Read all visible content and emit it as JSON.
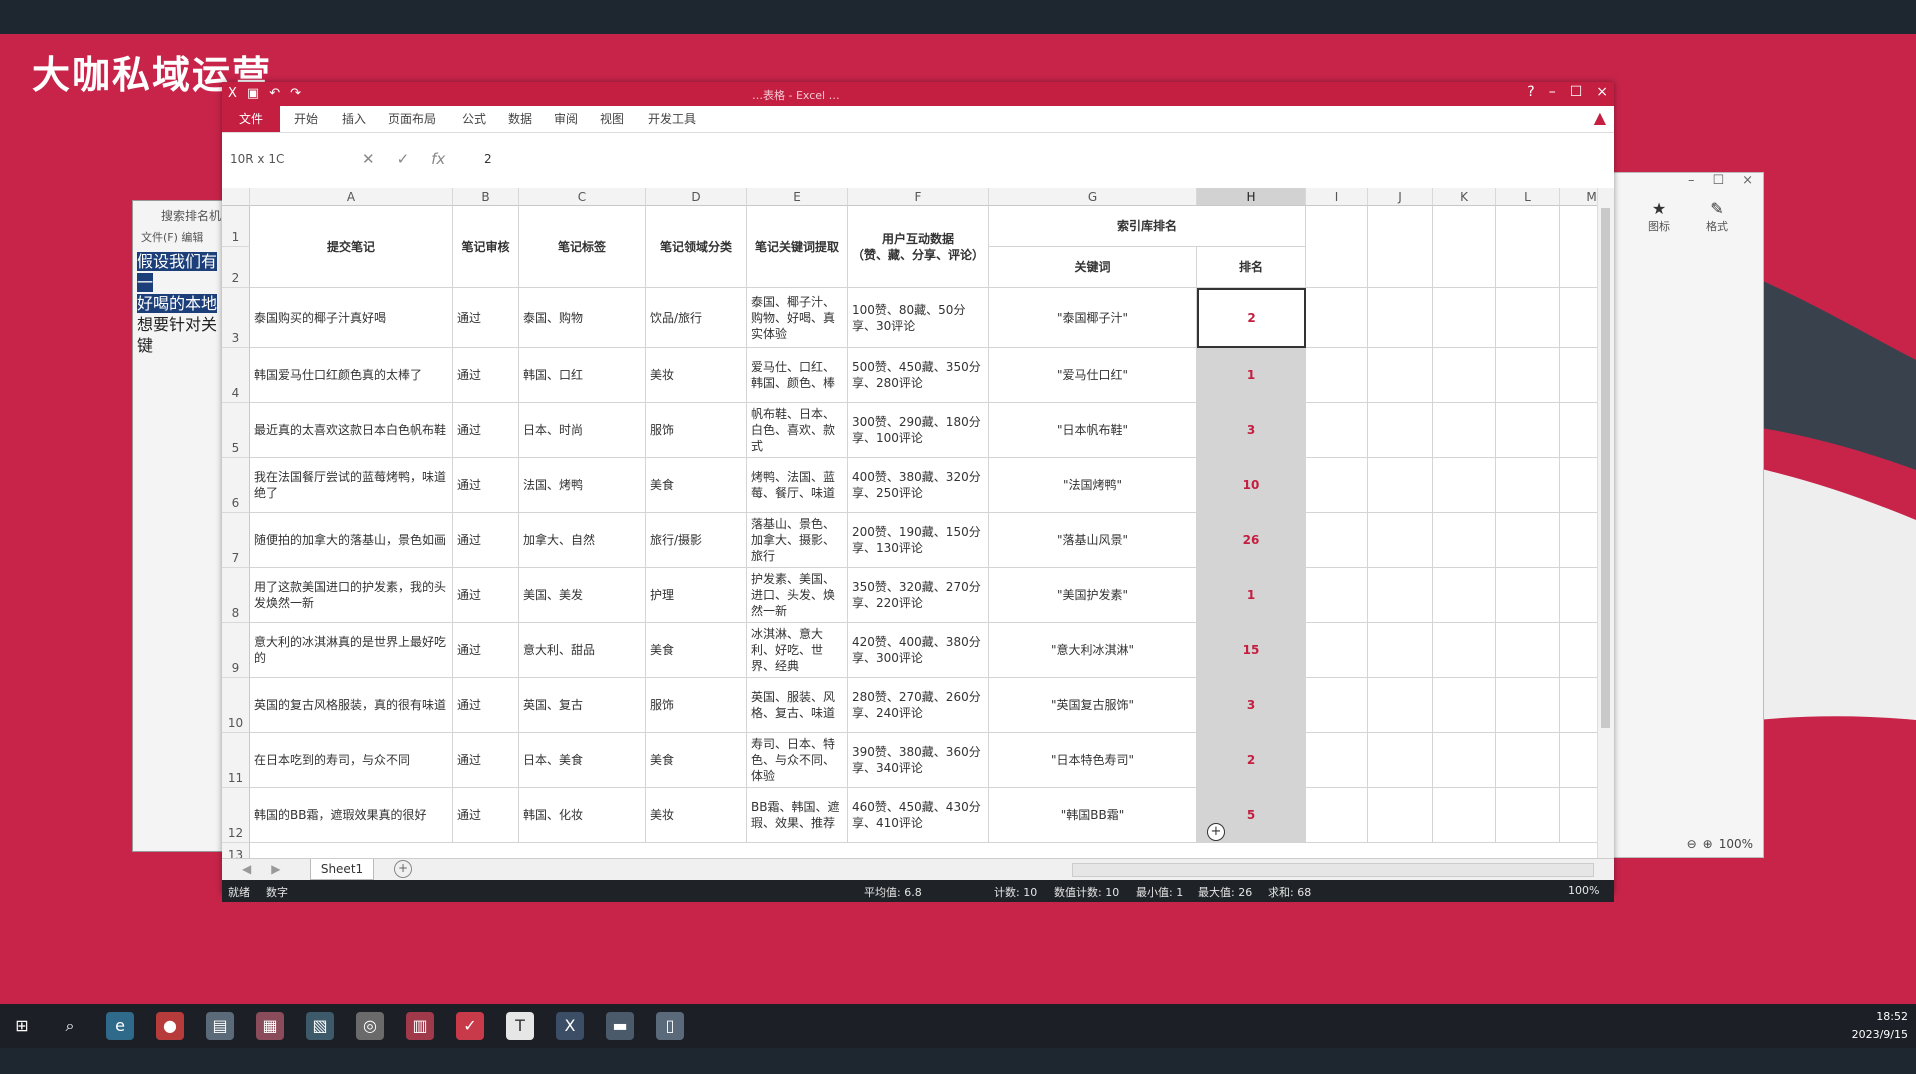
{
  "overlay": {
    "watermark": "大咖私域运营"
  },
  "note_window": {
    "title": "搜索排名机",
    "menu": "文件(F)  编辑",
    "lines": [
      "假设我们有一",
      "好喝的本地",
      "想要针对关键"
    ]
  },
  "side_panel": {
    "tools": [
      {
        "icon": "star-icon",
        "glyph": "★",
        "label": "图标"
      },
      {
        "icon": "brush-icon",
        "glyph": "✎",
        "label": "格式"
      }
    ],
    "zoom": "100%"
  },
  "excel": {
    "title": "…表格 - Excel …",
    "tabs": [
      "文件",
      "开始",
      "插入",
      "页面布局",
      "公式",
      "数据",
      "审阅",
      "视图",
      "开发工具"
    ],
    "name_box": "10R x 1C",
    "formula_value": "2",
    "columns": [
      "A",
      "B",
      "C",
      "D",
      "E",
      "F",
      "G",
      "H",
      "I",
      "J",
      "K",
      "L",
      "M"
    ],
    "header": {
      "submit_note": "提交笔记",
      "review": "笔记审核",
      "tags": "笔记标签",
      "domain": "笔记领域分类",
      "keywords": "笔记关键词提取",
      "interaction": "用户互动数据\n（赞、藏、分享、评论）",
      "index_rank": "索引库排名",
      "keyword": "关键词",
      "rank": "排名"
    },
    "rows": [
      {
        "n": "3",
        "note": "泰国购买的椰子汁真好喝",
        "review": "通过",
        "tags": "泰国、购物",
        "domain": "饮品/旅行",
        "kw": "泰国、椰子汁、购物、好喝、真实体验",
        "data": "100赞、80藏、50分享、30评论",
        "keyword": "\"泰国椰子汁\"",
        "rank": "2"
      },
      {
        "n": "4",
        "note": "韩国爱马仕口红颜色真的太棒了",
        "review": "通过",
        "tags": "韩国、口红",
        "domain": "美妆",
        "kw": "爱马仕、口红、韩国、颜色、棒",
        "data": "500赞、450藏、350分享、280评论",
        "keyword": "\"爱马仕口红\"",
        "rank": "1"
      },
      {
        "n": "5",
        "note": "最近真的太喜欢这款日本白色帆布鞋",
        "review": "通过",
        "tags": "日本、时尚",
        "domain": "服饰",
        "kw": "帆布鞋、日本、白色、喜欢、款式",
        "data": "300赞、290藏、180分享、100评论",
        "keyword": "\"日本帆布鞋\"",
        "rank": "3"
      },
      {
        "n": "6",
        "note": "我在法国餐厅尝试的蓝莓烤鸭，味道绝了",
        "review": "通过",
        "tags": "法国、烤鸭",
        "domain": "美食",
        "kw": "烤鸭、法国、蓝莓、餐厅、味道",
        "data": "400赞、380藏、320分享、250评论",
        "keyword": "\"法国烤鸭\"",
        "rank": "10"
      },
      {
        "n": "7",
        "note": "随便拍的加拿大的落基山，景色如画",
        "review": "通过",
        "tags": "加拿大、自然",
        "domain": "旅行/摄影",
        "kw": "落基山、景色、加拿大、摄影、旅行",
        "data": "200赞、190藏、150分享、130评论",
        "keyword": "\"落基山风景\"",
        "rank": "26"
      },
      {
        "n": "8",
        "note": "用了这款美国进口的护发素，我的头发焕然一新",
        "review": "通过",
        "tags": "美国、美发",
        "domain": "护理",
        "kw": "护发素、美国、进口、头发、焕然一新",
        "data": "350赞、320藏、270分享、220评论",
        "keyword": "\"美国护发素\"",
        "rank": "1"
      },
      {
        "n": "9",
        "note": "意大利的冰淇淋真的是世界上最好吃的",
        "review": "通过",
        "tags": "意大利、甜品",
        "domain": "美食",
        "kw": "冰淇淋、意大利、好吃、世界、经典",
        "data": "420赞、400藏、380分享、300评论",
        "keyword": "\"意大利冰淇淋\"",
        "rank": "15"
      },
      {
        "n": "10",
        "note": "英国的复古风格服装，真的很有味道",
        "review": "通过",
        "tags": "英国、复古",
        "domain": "服饰",
        "kw": "英国、服装、风格、复古、味道",
        "data": "280赞、270藏、260分享、240评论",
        "keyword": "\"英国复古服饰\"",
        "rank": "3"
      },
      {
        "n": "11",
        "note": "在日本吃到的寿司，与众不同",
        "review": "通过",
        "tags": "日本、美食",
        "domain": "美食",
        "kw": "寿司、日本、特色、与众不同、体验",
        "data": "390赞、380藏、360分享、340评论",
        "keyword": "\"日本特色寿司\"",
        "rank": "2"
      },
      {
        "n": "12",
        "note": "韩国的BB霜，遮瑕效果真的很好",
        "review": "通过",
        "tags": "韩国、化妆",
        "domain": "美妆",
        "kw": "BB霜、韩国、遮瑕、效果、推荐",
        "data": "460赞、450藏、430分享、410评论",
        "keyword": "\"韩国BB霜\"",
        "rank": "5"
      }
    ],
    "sheet_tab": "Sheet1",
    "status": {
      "ready": "就绪",
      "mode": "数字",
      "avg": "平均值: 6.8",
      "count": "计数: 10",
      "numcount": "数值计数: 10",
      "min": "最小值: 1",
      "max": "最大值: 26",
      "sum": "求和: 68",
      "zoom": "100%"
    }
  },
  "taskbar": {
    "time": "18:52",
    "date": "2023/9/15"
  },
  "colors": {
    "accent": "#c41f40",
    "rank_text": "#c41f40",
    "status_bg": "#1f2327"
  }
}
